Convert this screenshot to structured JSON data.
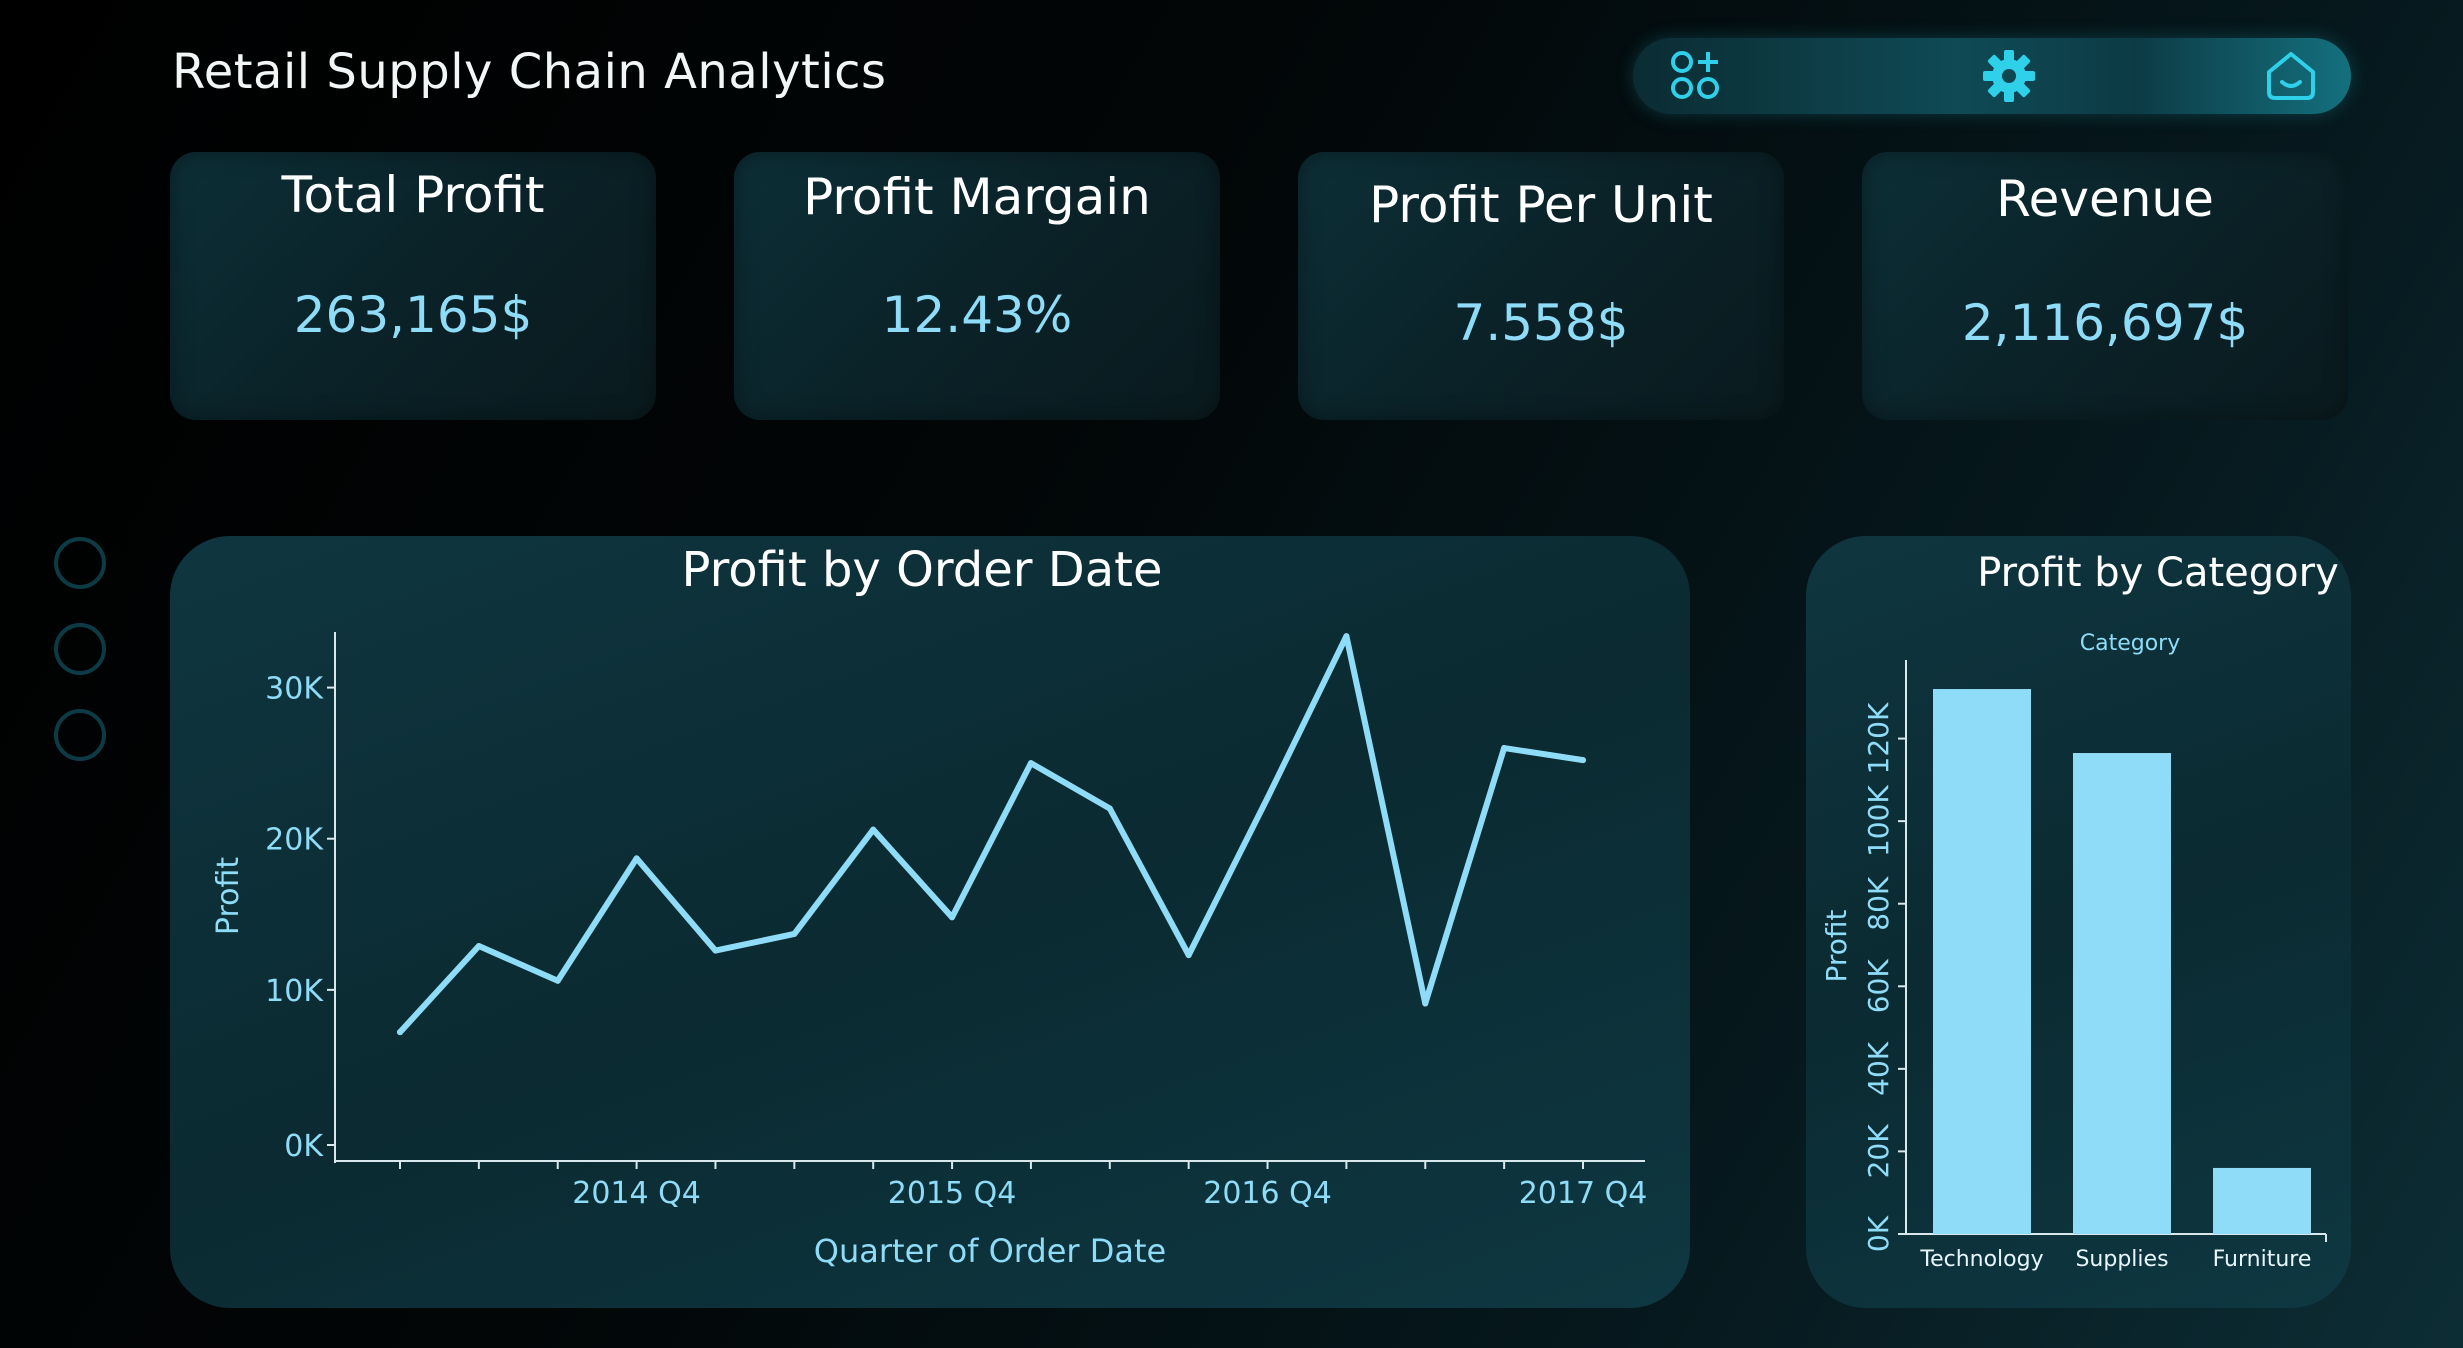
{
  "app": {
    "title": "Retail Supply Chain Analytics"
  },
  "toolbar": {
    "icons": [
      "grid-add-icon",
      "gear-icon",
      "home-icon"
    ],
    "accent": "#29c4de"
  },
  "kpis": [
    {
      "label": "Total Profit",
      "value": "263,165$"
    },
    {
      "label": "Profit Margain",
      "value": "12.43%"
    },
    {
      "label": "Profit Per Unit",
      "value": "7.558$"
    },
    {
      "label": "Revenue",
      "value": "2,116,697$"
    }
  ],
  "colors": {
    "line": "#8fdcf8",
    "bar": "#8fdcf8",
    "axis_text": "#8fdcf8",
    "title": "#ffffff"
  },
  "chart_data": [
    {
      "type": "line",
      "title": "Profit by Order Date",
      "xlabel": "Quarter of Order Date",
      "ylabel": "Profit",
      "x": [
        "2014 Q1",
        "2014 Q2",
        "2014 Q3",
        "2014 Q4",
        "2015 Q1",
        "2015 Q2",
        "2015 Q3",
        "2015 Q4",
        "2016 Q1",
        "2016 Q2",
        "2016 Q3",
        "2016 Q4",
        "2017 Q1",
        "2017 Q2",
        "2017 Q3",
        "2017 Q4"
      ],
      "values": [
        7200,
        12900,
        10600,
        18700,
        12600,
        13700,
        20600,
        14800,
        25000,
        22000,
        12300,
        22700,
        33400,
        9100,
        26000,
        25200
      ],
      "xtick_labels": [
        "2014 Q4",
        "2015 Q4",
        "2016 Q4",
        "2017 Q4"
      ],
      "ytick_labels": [
        "0K",
        "10K",
        "20K",
        "30K"
      ],
      "yticks": [
        0,
        10000,
        20000,
        30000
      ],
      "ylim": [
        0,
        35000
      ],
      "grid": false
    },
    {
      "type": "bar",
      "title": "Profit by Category",
      "legend_title": "Category",
      "ylabel": "Profit",
      "categories": [
        "Technology",
        "Supplies",
        "Furniture"
      ],
      "values": [
        132000,
        116500,
        16000
      ],
      "ytick_labels": [
        "0K",
        "20K",
        "40K",
        "60K",
        "80K",
        "100K",
        "120K"
      ],
      "yticks": [
        0,
        20000,
        40000,
        60000,
        80000,
        100000,
        120000
      ],
      "ylim": [
        0,
        140000
      ],
      "grid": false
    }
  ]
}
